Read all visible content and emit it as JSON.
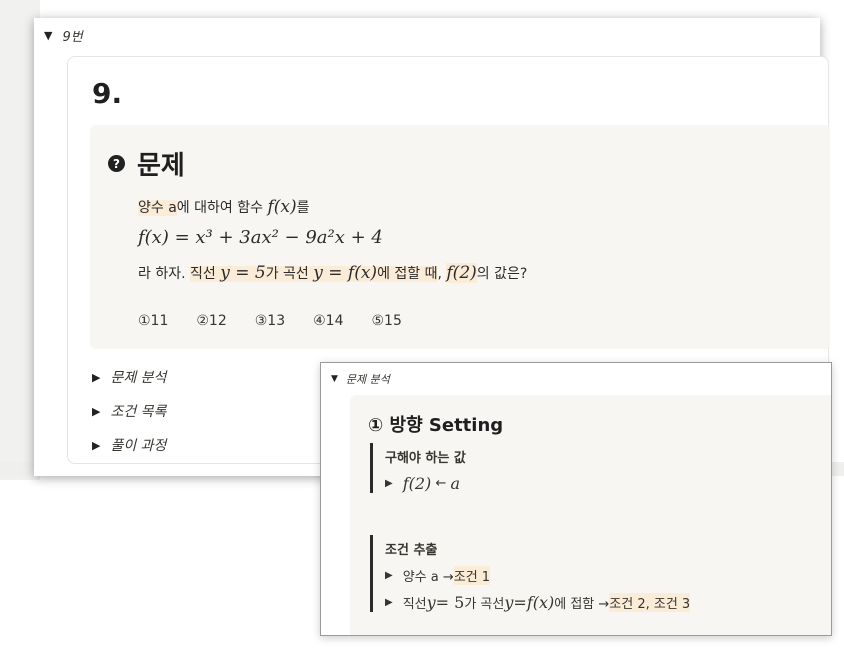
{
  "outer_toggle": {
    "label": "9번"
  },
  "card": {
    "title": "9."
  },
  "problem": {
    "title": "문제",
    "line1": {
      "hl": "양수 a",
      "t1": "에 대하여 함수 ",
      "fx": "f(x)",
      "t2": "를"
    },
    "formula": "f(x) = x³ + 3ax² − 9a²x + 4",
    "line3": {
      "t1": "라 하자. ",
      "hl1": "직선 ",
      "y1": "y = 5",
      "hl2": "가 곡선 ",
      "y2": "y = f(x)",
      "hl3": "에 접할 때",
      "t2": ", ",
      "f2": "f(2)",
      "t3": "의 값은?"
    },
    "choices": [
      "①11",
      "②12",
      "③13",
      "④14",
      "⑤15"
    ]
  },
  "sub_toggles": [
    "문제 분석",
    "조건 목록",
    "풀이 과정"
  ],
  "popup": {
    "header": "문제 분석",
    "heading": "① 방향 Setting",
    "block1": {
      "label": "구해야 하는 값",
      "item_f": "f(2)",
      "item_arrow": "←",
      "item_a": "a"
    },
    "block2": {
      "label": "조건 추출",
      "item1": {
        "text": "양수 a → ",
        "hl": "조건 1"
      },
      "item2": {
        "t1": "직선 ",
        "y1": "y",
        "eq1": " = 5",
        "t2": "가 곡선 ",
        "y2": "y",
        "eq2": " = ",
        "fx": "f(x)",
        "t3": "에 접함 → ",
        "hl": "조건 2, 조건 3"
      }
    }
  }
}
